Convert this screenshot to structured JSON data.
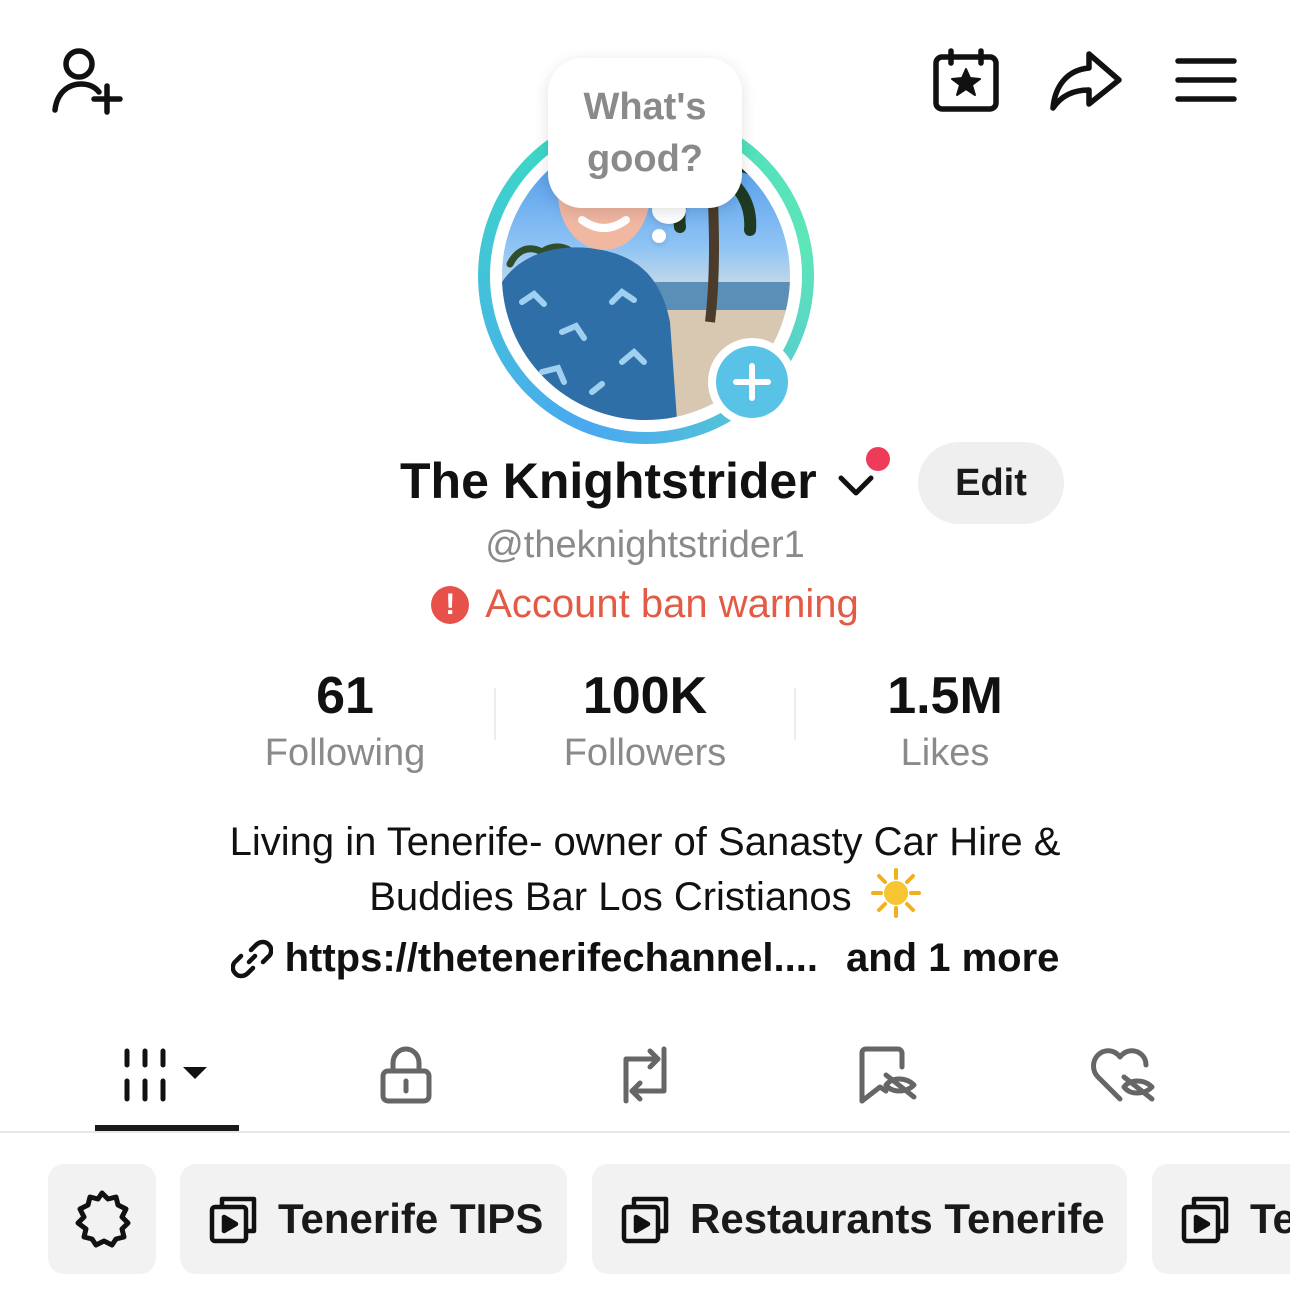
{
  "header": {
    "add_friend_icon": "person-plus-icon",
    "calendar_icon": "calendar-star-icon",
    "share_icon": "share-arrow-icon",
    "menu_icon": "hamburger-menu-icon"
  },
  "avatar": {
    "status_bubble": "What's\ngood?",
    "add_icon": "plus-icon",
    "ring_colors": [
      "#4aa8f0",
      "#3dd6c8"
    ]
  },
  "profile": {
    "display_name": "The Knightstrider",
    "edit_label": "Edit",
    "username": "@theknightstrider1",
    "warning_text": "Account ban warning",
    "warning_color": "#e35a45"
  },
  "stats": [
    {
      "value": "61",
      "label": "Following"
    },
    {
      "value": "100K",
      "label": "Followers"
    },
    {
      "value": "1.5M",
      "label": "Likes"
    }
  ],
  "bio": {
    "line1": "Living in Tenerife- owner of Sanasty Car Hire &",
    "line2": "Buddies Bar Los Cristianos",
    "emoji": "☀️",
    "link_text": "https://thetenerifechannel....",
    "more_text": "and 1 more"
  },
  "tabs": [
    {
      "icon": "videos-grid-icon",
      "active": true
    },
    {
      "icon": "lock-icon",
      "active": false
    },
    {
      "icon": "repost-icon",
      "active": false
    },
    {
      "icon": "favorites-hidden-icon",
      "active": false
    },
    {
      "icon": "liked-hidden-icon",
      "active": false
    }
  ],
  "playlists": {
    "settings_icon": "gear-icon",
    "items": [
      "Tenerife TIPS",
      "Restaurants Tenerife",
      "Te"
    ]
  }
}
